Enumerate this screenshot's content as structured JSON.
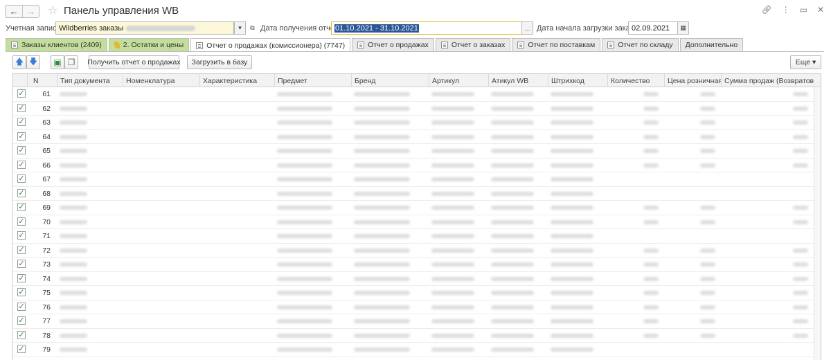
{
  "window": {
    "title": "Панель управления WB"
  },
  "filters": {
    "account_label": "Учетная запись:",
    "account_value": "Wildberries заказы",
    "report_date_label": "Дата получения отчета:",
    "report_date_value": "01.10.2021 - 31.10.2021",
    "orders_start_label": "Дата начала загрузки заказов:",
    "orders_start_value": "02.09.2021"
  },
  "tabs": [
    {
      "label": "Заказы клиентов (2409)"
    },
    {
      "label": "2. Остатки и цены"
    },
    {
      "label": "Отчет о продажах (комиссионера) (7747)"
    },
    {
      "label": "Отчет о продажах"
    },
    {
      "label": "Отчет о заказах"
    },
    {
      "label": "Отчет по поставкам"
    },
    {
      "label": "Отчет по складу"
    },
    {
      "label": "Дополнительно"
    }
  ],
  "toolbar": {
    "get_report_label": "Получить отчет о продажах",
    "load_db_label": "Загрузить в базу",
    "more_label": "Еще"
  },
  "table": {
    "columns": [
      "N",
      "Тип документа",
      "Номенклатура",
      "Характеристика",
      "Предмет",
      "Бренд",
      "Артикул",
      "Атикул WB",
      "Штрихкод",
      "Количество",
      "Цена розничная",
      "Сумма продаж (Возвратов)"
    ],
    "rows": [
      {
        "n": "61"
      },
      {
        "n": "62"
      },
      {
        "n": "63"
      },
      {
        "n": "64"
      },
      {
        "n": "65"
      },
      {
        "n": "66"
      },
      {
        "n": "67"
      },
      {
        "n": "68"
      },
      {
        "n": "69"
      },
      {
        "n": "70"
      },
      {
        "n": "71"
      },
      {
        "n": "72"
      },
      {
        "n": "73"
      },
      {
        "n": "74"
      },
      {
        "n": "75"
      },
      {
        "n": "76"
      },
      {
        "n": "77"
      },
      {
        "n": "78"
      },
      {
        "n": "79"
      }
    ]
  },
  "icons": {
    "back": "arrow-left-icon",
    "forward": "arrow-right-icon",
    "favorite": "star-icon",
    "link": "link-icon",
    "menu": "kebab-menu-icon",
    "maximize": "maximize-icon",
    "close": "close-icon",
    "checkbox": "checkmark-icon"
  },
  "colors": {
    "green_tab": "#c3dd9b",
    "selection": "#2b5797",
    "focus_border": "#e3b62b",
    "check": "#2e8b37"
  }
}
